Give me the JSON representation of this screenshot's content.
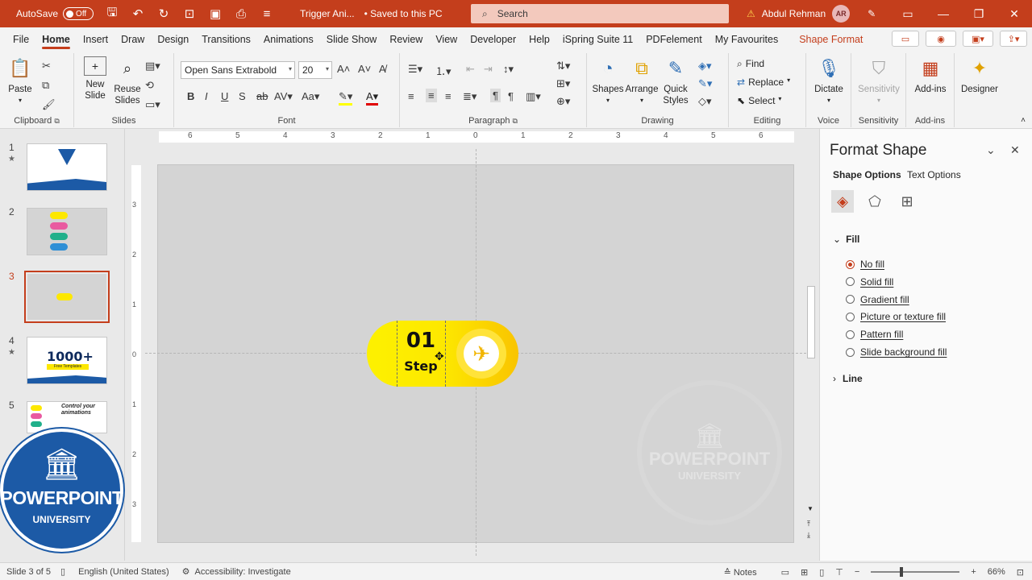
{
  "titlebar": {
    "autosave_label": "AutoSave",
    "autosave_state": "Off",
    "doc_title": "Trigger Ani...",
    "save_status": "• Saved to this PC",
    "search_placeholder": "Search",
    "user_name": "Abdul Rehman",
    "user_initials": "AR"
  },
  "tabs": [
    "File",
    "Home",
    "Insert",
    "Draw",
    "Design",
    "Transitions",
    "Animations",
    "Slide Show",
    "Review",
    "View",
    "Developer",
    "Help",
    "iSpring Suite 11",
    "PDFelement",
    "My Favourites"
  ],
  "active_tab": "Home",
  "contextual_tab": "Shape Format",
  "ribbon": {
    "clipboard": {
      "paste": "Paste",
      "label": "Clipboard"
    },
    "slides": {
      "new_slide": "New Slide",
      "reuse_slides": "Reuse Slides",
      "label": "Slides"
    },
    "font": {
      "font_name": "Open Sans Extrabold",
      "font_size": "20",
      "label": "Font"
    },
    "paragraph": {
      "label": "Paragraph"
    },
    "drawing": {
      "shapes": "Shapes",
      "arrange": "Arrange",
      "quick_styles": "Quick Styles",
      "label": "Drawing"
    },
    "editing": {
      "find": "Find",
      "replace": "Replace",
      "select": "Select",
      "label": "Editing"
    },
    "voice": {
      "dictate": "Dictate",
      "label": "Voice"
    },
    "sensitivity": {
      "button": "Sensitivity",
      "label": "Sensitivity"
    },
    "addins": {
      "button": "Add-ins",
      "label": "Add-ins"
    },
    "designer": {
      "button": "Designer"
    }
  },
  "thumbnails": [
    {
      "num": "1",
      "star": true
    },
    {
      "num": "2",
      "star": false
    },
    {
      "num": "3",
      "star": false,
      "selected": true
    },
    {
      "num": "4",
      "star": true,
      "banner": "1000+",
      "sub": "Free Templates"
    },
    {
      "num": "5",
      "star": false,
      "caption": "Control your animations"
    }
  ],
  "ruler": {
    "h_labels": [
      "6",
      "5",
      "4",
      "3",
      "2",
      "1",
      "0",
      "1",
      "2",
      "3",
      "4",
      "5",
      "6"
    ],
    "v_labels": [
      "3",
      "2",
      "1",
      "0",
      "1",
      "2",
      "3"
    ]
  },
  "slide": {
    "number": "01",
    "word": "Step",
    "watermark_title": "POWERPOINT",
    "watermark_sub": "UNIVERSITY"
  },
  "logo": {
    "title": "POWERPOINT",
    "sub": "UNIVERSITY"
  },
  "pane": {
    "title": "Format Shape",
    "tab_shape": "Shape Options",
    "tab_text": "Text Options",
    "fill_header": "Fill",
    "fill_options": [
      "No fill",
      "Solid fill",
      "Gradient fill",
      "Picture or texture fill",
      "Pattern fill",
      "Slide background fill"
    ],
    "fill_selected": "No fill",
    "line_header": "Line"
  },
  "status": {
    "slide_pos": "Slide 3 of 5",
    "language": "English (United States)",
    "accessibility": "Accessibility: Investigate",
    "notes": "Notes",
    "zoom": "66%",
    "zoom_level": 0.66
  },
  "colors": {
    "accent": "#c43e1c",
    "pill_yellow": "#fde800",
    "logo_blue": "#1c5aa6"
  }
}
